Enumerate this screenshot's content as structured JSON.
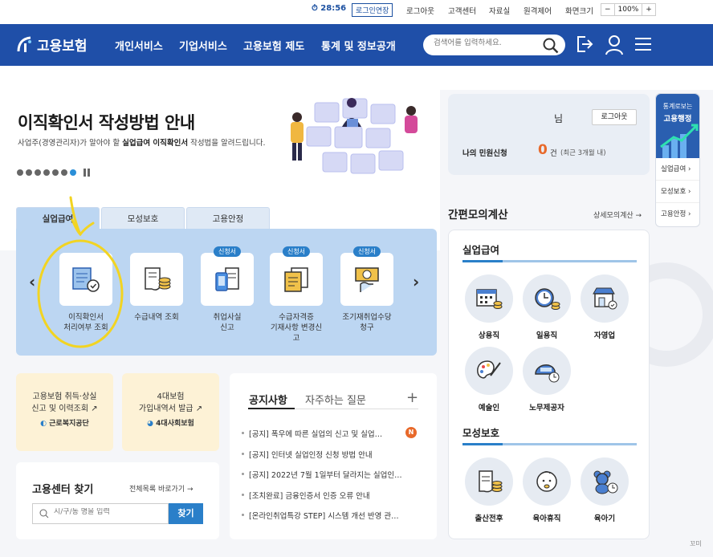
{
  "util": {
    "timer": "28:56",
    "extend": "로그인연장",
    "links": [
      "로그아웃",
      "고객센터",
      "자료실",
      "원격제어",
      "화면크기"
    ],
    "zoom_minus": "−",
    "zoom_value": "100%",
    "zoom_plus": "+"
  },
  "nav": {
    "logo": "고용보험",
    "menu": [
      "개인서비스",
      "기업서비스",
      "고용보험 제도",
      "통계 및 정보공개"
    ],
    "search_placeholder": "검색어를 입력하세요."
  },
  "hero": {
    "title": "이직확인서 작성방법 안내",
    "sub_pre": "사업주(경영관리자)가 알아야 할 ",
    "sub_bold": "실업급여 이직확인서",
    "sub_post": " 작성법을 알려드립니다."
  },
  "tabs": [
    "실업급여",
    "모성보호",
    "고용안정"
  ],
  "services": [
    {
      "label1": "이직확인서",
      "label2": "처리여부 조회",
      "badge": ""
    },
    {
      "label1": "수급내역 조회",
      "label2": "",
      "badge": ""
    },
    {
      "label1": "취업사실",
      "label2": "신고",
      "badge": "신청서"
    },
    {
      "label1": "수급자격증",
      "label2": "기재사항 변경신고",
      "badge": "신청서"
    },
    {
      "label1": "조기재취업수당",
      "label2": "청구",
      "badge": "신청서"
    }
  ],
  "cards": {
    "c1_line1": "고용보험 취득·상실",
    "c1_line2": "신고 및 이력조회",
    "c1_org": "근로복지공단",
    "c2_line1": "4대보험",
    "c2_line2": "가입내역서 발급",
    "c2_org": "4대사회보험"
  },
  "center": {
    "title": "고용센터 찾기",
    "all": "전체목록 바로가기",
    "placeholder": "시/구/동 명을 입력",
    "button": "찾기"
  },
  "notice": {
    "tab1": "공지사항",
    "tab2": "자주하는 질문",
    "plus": "+",
    "new_badge": "N",
    "items": [
      "[공지] 폭우에 따른 실업의 신고 및 실업…",
      "[공지] 인터넷 실업인정 신청 방법 안내",
      "[공지] 2022년 7월 1일부터 달라지는 실업인…",
      "[조치완료] 금융인증서 인증 오류 안내",
      "[온라인취업특강 STEP] 시스템 개선 반영 관…"
    ]
  },
  "mini": {
    "name": "님",
    "logout": "로그아웃",
    "label": "나의 민원신청",
    "count": "0",
    "count_unit": "건",
    "count_note": "(최근 3개월 내)"
  },
  "calc": {
    "title": "간편모의계산",
    "detail": "상세모의계산",
    "sec1": "실업급여",
    "sec1_items": [
      "상용직",
      "일용직",
      "자영업",
      "예술인",
      "노무제공자"
    ],
    "sec2": "모성보호",
    "sec2_items": [
      "출산전후",
      "육아휴직",
      "육아기"
    ]
  },
  "side": {
    "top1": "통계로보는",
    "top2": "고용행정",
    "items": [
      "실업급여",
      "모성보호",
      "고용안정"
    ]
  },
  "watermark": "꼬미",
  "colors": {
    "nav": "#1f4fa8",
    "accent": "#2a7fc9",
    "panel": "#bcd6f2",
    "card_yellow": "#fdf2d6",
    "highlight": "#f2d422"
  }
}
